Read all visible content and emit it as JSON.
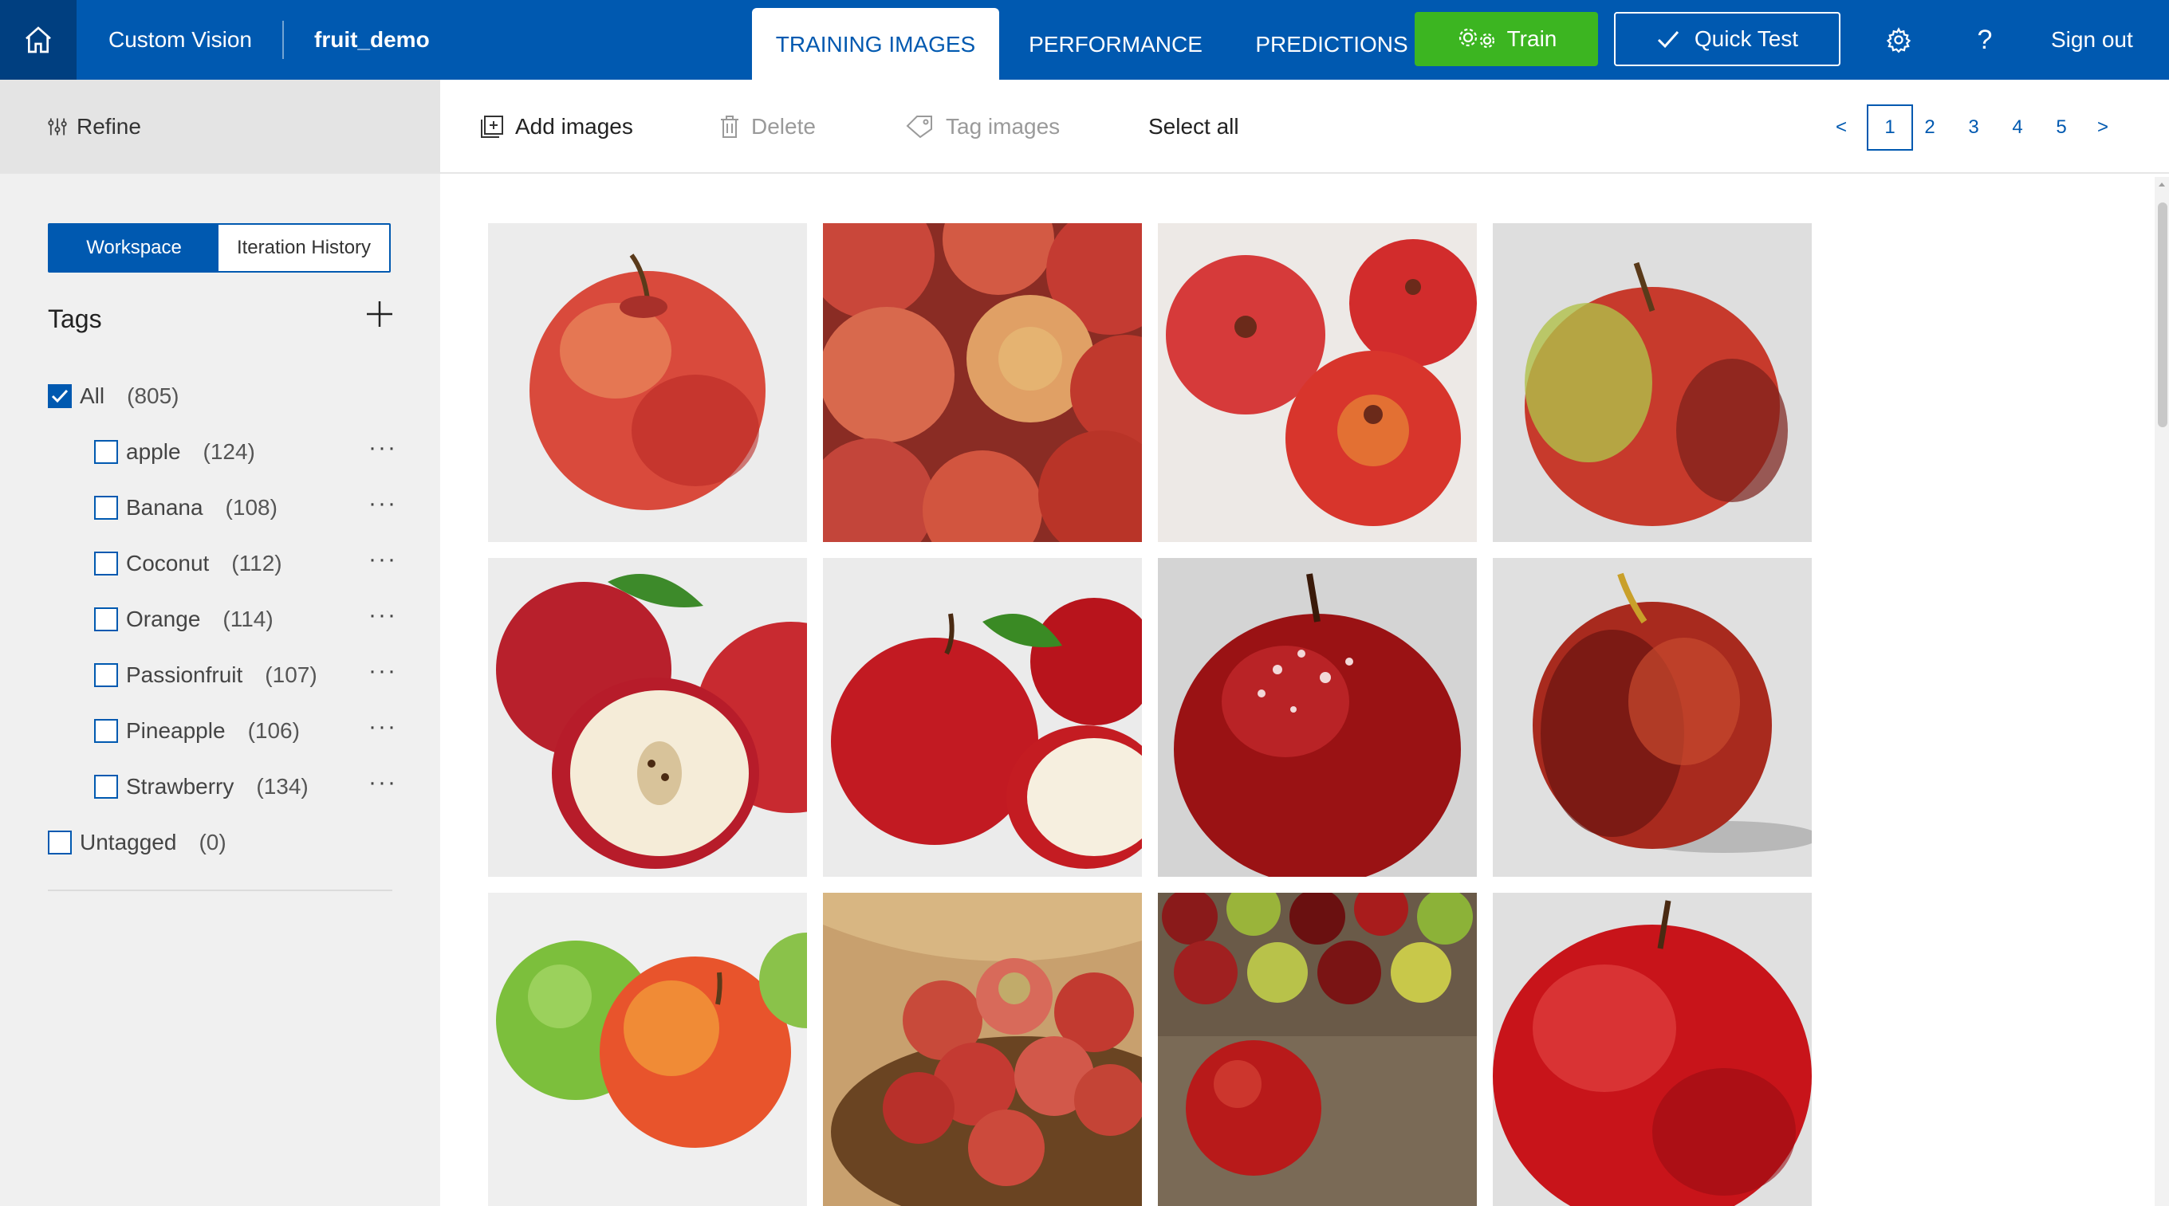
{
  "topbar": {
    "brand": "Custom Vision",
    "project": "fruit_demo",
    "tabs": [
      "TRAINING IMAGES",
      "PERFORMANCE",
      "PREDICTIONS"
    ],
    "active_tab": "TRAINING IMAGES",
    "train_label": "Train",
    "quick_test_label": "Quick Test",
    "sign_out_label": "Sign out",
    "accent_color": "#0059b0",
    "train_color": "#3cb521"
  },
  "left_panel": {
    "refine_label": "Refine",
    "segments": [
      "Workspace",
      "Iteration History"
    ],
    "active_segment": "Workspace",
    "tags_title": "Tags",
    "all_tag": {
      "name": "All",
      "count": "(805)",
      "checked": true
    },
    "tags": [
      {
        "name": "apple",
        "count": "(124)"
      },
      {
        "name": "Banana",
        "count": "(108)"
      },
      {
        "name": "Coconut",
        "count": "(112)"
      },
      {
        "name": "Orange",
        "count": "(114)"
      },
      {
        "name": "Passionfruit",
        "count": "(107)"
      },
      {
        "name": "Pineapple",
        "count": "(106)"
      },
      {
        "name": "Strawberry",
        "count": "(134)"
      }
    ],
    "untagged": {
      "name": "Untagged",
      "count": "(0)",
      "checked": false
    }
  },
  "toolbar": {
    "add_images": "Add images",
    "delete": "Delete",
    "tag_images": "Tag images",
    "select_all": "Select all",
    "pages": [
      "1",
      "2",
      "3",
      "4",
      "5"
    ],
    "current_page": "1",
    "prev": "<",
    "next": ">"
  },
  "images": [
    {
      "subject": "single red apple on grey background"
    },
    {
      "subject": "pile of red apples"
    },
    {
      "subject": "three red apples on white"
    },
    {
      "subject": "single red-green apple"
    },
    {
      "subject": "apple with leaf and half-cut apple"
    },
    {
      "subject": "red apples with leaf and slice"
    },
    {
      "subject": "dark red apple with water droplets"
    },
    {
      "subject": "single dark red apple"
    },
    {
      "subject": "green and red apple"
    },
    {
      "subject": "apples in a wicker basket"
    },
    {
      "subject": "apples on market table"
    },
    {
      "subject": "large red apple close-up"
    }
  ]
}
